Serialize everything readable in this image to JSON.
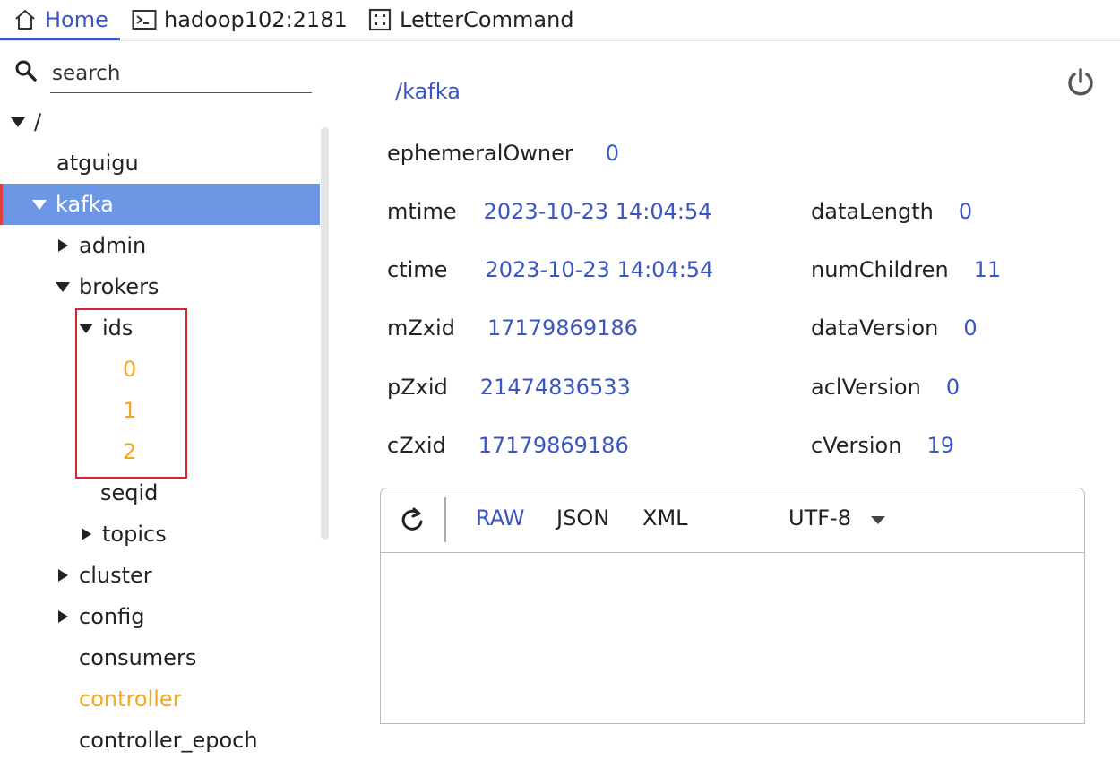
{
  "tabs": {
    "home": "Home",
    "connection": "hadoop102:2181",
    "letter_command": "LetterCommand"
  },
  "search": {
    "placeholder": "search"
  },
  "tree": [
    {
      "label": "/",
      "depth": 0,
      "toggle": "down"
    },
    {
      "label": "atguigu",
      "depth": 1,
      "toggle": "none"
    },
    {
      "label": "kafka",
      "depth": 1,
      "toggle": "down",
      "selected": true
    },
    {
      "label": "admin",
      "depth": 2,
      "toggle": "right"
    },
    {
      "label": "brokers",
      "depth": 2,
      "toggle": "down"
    },
    {
      "label": "ids",
      "depth": 3,
      "toggle": "down"
    },
    {
      "label": "0",
      "depth": 4,
      "toggle": "none",
      "ephemeral": true
    },
    {
      "label": "1",
      "depth": 4,
      "toggle": "none",
      "ephemeral": true
    },
    {
      "label": "2",
      "depth": 4,
      "toggle": "none",
      "ephemeral": true
    },
    {
      "label": "seqid",
      "depth": 3,
      "toggle": "none"
    },
    {
      "label": "topics",
      "depth": 3,
      "toggle": "right"
    },
    {
      "label": "cluster",
      "depth": 2,
      "toggle": "right"
    },
    {
      "label": "config",
      "depth": 2,
      "toggle": "right"
    },
    {
      "label": "consumers",
      "depth": 2,
      "toggle": "none"
    },
    {
      "label": "controller",
      "depth": 2,
      "toggle": "none",
      "ephemeral": true
    },
    {
      "label": "controller_epoch",
      "depth": 2,
      "toggle": "none"
    }
  ],
  "detail": {
    "path": "/kafka",
    "ephemeralOwner": {
      "key": "ephemeralOwner",
      "value": "0"
    },
    "mtime": {
      "key": "mtime",
      "value": "2023-10-23 14:04:54"
    },
    "ctime": {
      "key": "ctime",
      "value": "2023-10-23 14:04:54"
    },
    "mZxid": {
      "key": "mZxid",
      "value": "17179869186"
    },
    "pZxid": {
      "key": "pZxid",
      "value": "21474836533"
    },
    "cZxid": {
      "key": "cZxid",
      "value": "17179869186"
    },
    "dataLength": {
      "key": "dataLength",
      "value": "0"
    },
    "numChildren": {
      "key": "numChildren",
      "value": "11"
    },
    "dataVersion": {
      "key": "dataVersion",
      "value": "0"
    },
    "aclVersion": {
      "key": "aclVersion",
      "value": "0"
    },
    "cVersion": {
      "key": "cVersion",
      "value": "19"
    }
  },
  "viewer": {
    "formats": [
      "RAW",
      "JSON",
      "XML"
    ],
    "active_format": "RAW",
    "encoding": "UTF-8"
  },
  "colors": {
    "accent": "#3a56c4",
    "selected_row": "#6b97e5",
    "ephemeral_node": "#f5a623",
    "highlight_box": "#d9262e"
  },
  "icons": [
    "home-icon",
    "terminal-icon",
    "grid-icon",
    "search-icon",
    "power-icon",
    "refresh-icon",
    "chevron-down-icon"
  ]
}
